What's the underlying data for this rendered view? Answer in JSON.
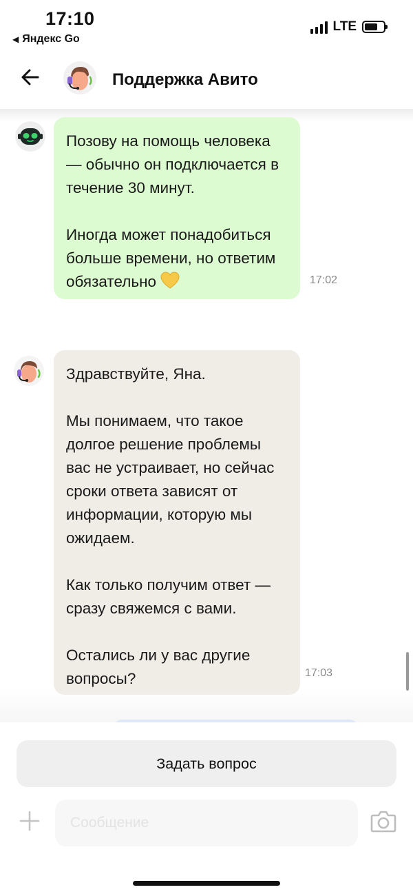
{
  "status_bar": {
    "time": "17:10",
    "back_app": "Яндекс Go",
    "network": "LTE"
  },
  "header": {
    "title": "Поддержка Авито"
  },
  "messages": [
    {
      "sender": "bot",
      "avatar_icon": "robot-icon",
      "paragraphs": [
        "Позову на помощь человека — обычно он подключается в течение 30 минут.",
        "Иногда может понадобиться больше времени, но ответим обязательно"
      ],
      "emoji": "yellow-heart-icon",
      "time": "17:02"
    },
    {
      "sender": "agent",
      "avatar_icon": "support-agent-icon",
      "paragraphs": [
        "Здравствуйте, Яна.",
        "Мы понимаем, что такое долгое решение проблемы вас не устраивает, но сейчас сроки ответа зависят от информации, которую мы ожидаем.",
        "Как только получим ответ — сразу свяжемся с вами.",
        "Остались ли у вас другие вопросы?"
      ],
      "time": "17:03"
    }
  ],
  "composer": {
    "ask_button_label": "Задать вопрос",
    "input_value": "",
    "input_placeholder": "Сообщение"
  },
  "colors": {
    "bot_bubble": "#dcfbd0",
    "agent_bubble": "#f0ede7",
    "button_bg": "#efefef"
  }
}
